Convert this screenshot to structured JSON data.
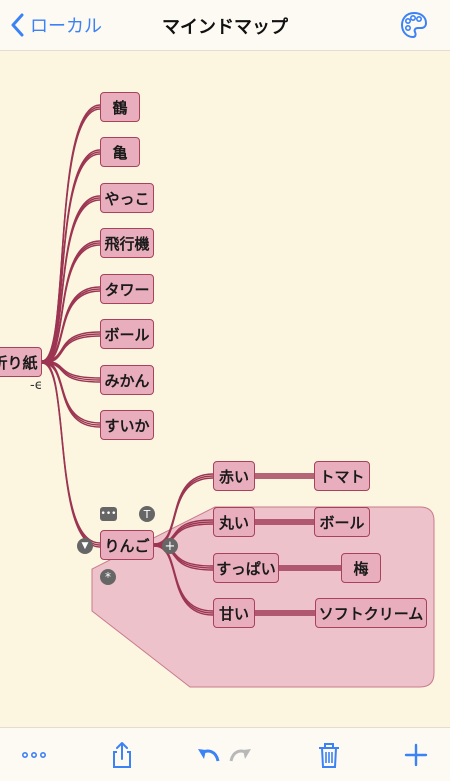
{
  "nav": {
    "back_label": "ローカル",
    "title": "マインドマップ"
  },
  "root": {
    "label": "折り紙"
  },
  "branches": [
    "鶴",
    "亀",
    "やっこ",
    "飛行機",
    "タワー",
    "ボール",
    "みかん",
    "すいか"
  ],
  "apple": {
    "label": "りんご",
    "children": [
      {
        "label": "赤い",
        "child": "トマト"
      },
      {
        "label": "丸い",
        "child": "ボール"
      },
      {
        "label": "すっぱい",
        "child": "梅"
      },
      {
        "label": "甘い",
        "child": "ソフトクリーム"
      }
    ]
  },
  "colors": {
    "accent": "#3b82f6",
    "node_fill": "#e8aebd",
    "node_border": "#a8425c",
    "background": "#fcf6e0"
  }
}
